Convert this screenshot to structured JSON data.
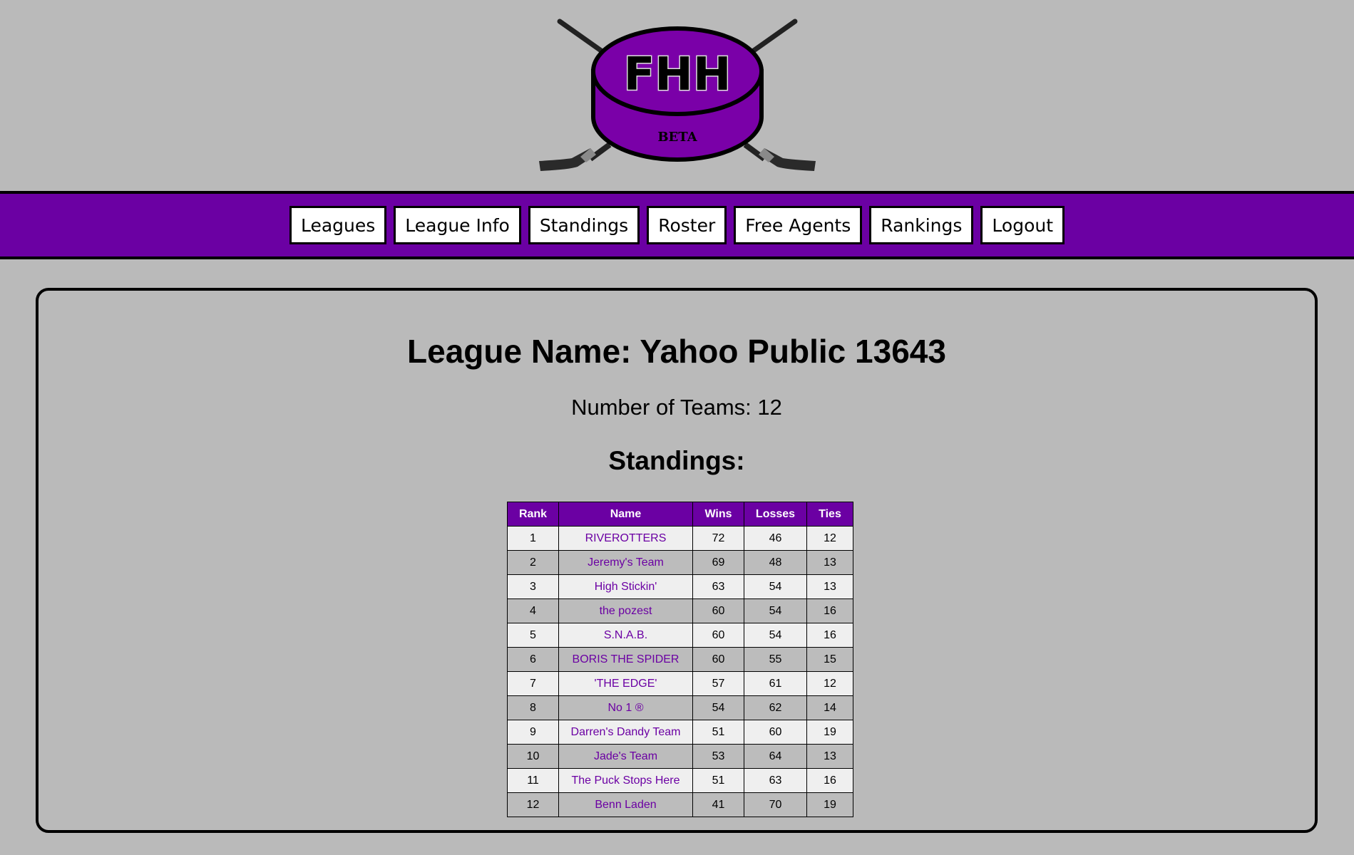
{
  "logo": {
    "main_text": "FHH",
    "sub_text": "BETA",
    "primary_color": "#7a00a8",
    "icon": "hockey-puck-sticks-icon"
  },
  "nav": {
    "items": [
      {
        "label": "Leagues"
      },
      {
        "label": "League Info"
      },
      {
        "label": "Standings"
      },
      {
        "label": "Roster"
      },
      {
        "label": "Free Agents"
      },
      {
        "label": "Rankings"
      },
      {
        "label": "Logout"
      }
    ],
    "background_color": "#6b00a3"
  },
  "league": {
    "title": "League Name: Yahoo Public 13643",
    "num_teams_text": "Number of Teams: 12",
    "standings_heading": "Standings:"
  },
  "standings": {
    "columns": [
      "Rank",
      "Name",
      "Wins",
      "Losses",
      "Ties"
    ],
    "rows": [
      {
        "rank": "1",
        "name": "RIVEROTTERS",
        "wins": "72",
        "losses": "46",
        "ties": "12"
      },
      {
        "rank": "2",
        "name": "Jeremy's Team",
        "wins": "69",
        "losses": "48",
        "ties": "13"
      },
      {
        "rank": "3",
        "name": "High Stickin'",
        "wins": "63",
        "losses": "54",
        "ties": "13"
      },
      {
        "rank": "4",
        "name": "the pozest",
        "wins": "60",
        "losses": "54",
        "ties": "16"
      },
      {
        "rank": "5",
        "name": "S.N.A.B.",
        "wins": "60",
        "losses": "54",
        "ties": "16"
      },
      {
        "rank": "6",
        "name": "BORIS THE SPIDER",
        "wins": "60",
        "losses": "55",
        "ties": "15"
      },
      {
        "rank": "7",
        "name": "'THE EDGE'",
        "wins": "57",
        "losses": "61",
        "ties": "12"
      },
      {
        "rank": "8",
        "name": "No 1 ®",
        "wins": "54",
        "losses": "62",
        "ties": "14"
      },
      {
        "rank": "9",
        "name": "Darren's Dandy Team",
        "wins": "51",
        "losses": "60",
        "ties": "19"
      },
      {
        "rank": "10",
        "name": "Jade's Team",
        "wins": "53",
        "losses": "64",
        "ties": "13"
      },
      {
        "rank": "11",
        "name": "The Puck Stops Here",
        "wins": "51",
        "losses": "63",
        "ties": "16"
      },
      {
        "rank": "12",
        "name": "Benn Laden",
        "wins": "41",
        "losses": "70",
        "ties": "19"
      }
    ]
  }
}
